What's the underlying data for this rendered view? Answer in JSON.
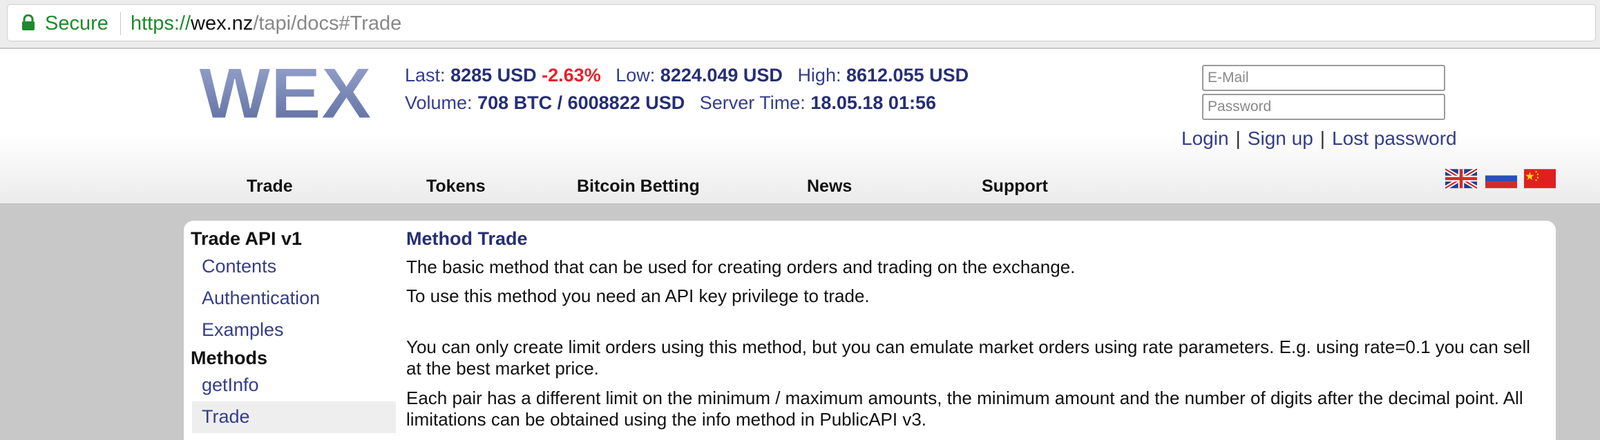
{
  "browser": {
    "secure_label": "Secure",
    "url_scheme": "https://",
    "url_host": "wex.nz",
    "url_path": "/tapi/docs#Trade"
  },
  "site": {
    "logo_text": "WEX"
  },
  "ticker": {
    "last_label": "Last:",
    "last_value": "8285 USD",
    "change": "-2.63%",
    "low_label": "Low:",
    "low_value": "8224.049 USD",
    "high_label": "High:",
    "high_value": "8612.055 USD",
    "volume_label": "Volume:",
    "volume_value": "708 BTC / 6008822 USD",
    "server_time_label": "Server Time:",
    "server_time_value": "18.05.18 01:56"
  },
  "auth": {
    "email_placeholder": "E-Mail",
    "password_placeholder": "Password",
    "login": "Login",
    "separator": "|",
    "signup": "Sign up",
    "lost_password": "Lost password"
  },
  "nav": {
    "items": [
      "Trade",
      "Tokens",
      "Bitcoin Betting",
      "News",
      "Support"
    ]
  },
  "languages": [
    "english-flag-icon",
    "russian-flag-icon",
    "chinese-flag-icon"
  ],
  "sidebar": {
    "section1_title": "Trade API v1",
    "section1_links": [
      "Contents",
      "Authentication",
      "Examples"
    ],
    "section2_title": "Methods",
    "section2_links": [
      "getInfo",
      "Trade"
    ],
    "active": "Trade"
  },
  "content": {
    "title": "Method Trade",
    "paragraphs": [
      "The basic method that can be used for creating orders and trading on the exchange.",
      "To use this method you need an API key privilege to trade.",
      "You can only create limit orders using this method, but you can emulate market orders using rate parameters. E.g. using rate=0.1 you can sell at the best market price.",
      "Each pair has a different limit on the minimum / maximum amounts, the minimum amount and the number of digits after the decimal point. All limitations can be obtained using the info method in PublicAPI v3."
    ]
  },
  "colors": {
    "link": "#343d8b",
    "negative": "#e8202a",
    "secure_green": "#1e8a2e"
  }
}
